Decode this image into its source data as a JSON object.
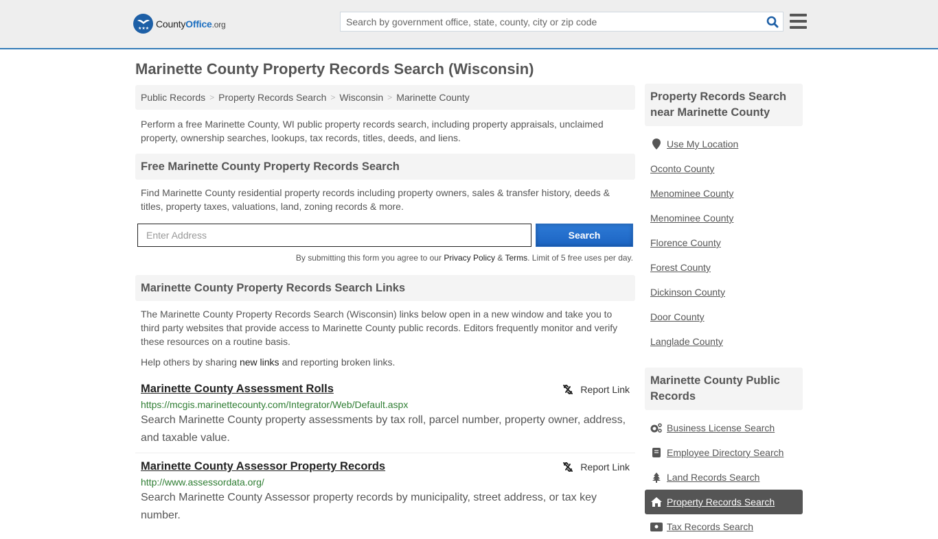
{
  "header": {
    "logo": {
      "county": "County",
      "office": "Office",
      "tld": ".org"
    },
    "search_placeholder": "Search by government office, state, county, city or zip code"
  },
  "page_title": "Marinette County Property Records Search (Wisconsin)",
  "breadcrumb": [
    "Public Records",
    "Property Records Search",
    "Wisconsin",
    "Marinette County"
  ],
  "intro": "Perform a free Marinette County, WI public property records search, including property appraisals, unclaimed property, ownership searches, lookups, tax records, titles, deeds, and liens.",
  "free_search": {
    "heading": "Free Marinette County Property Records Search",
    "description": "Find Marinette County residential property records including property owners, sales & transfer history, deeds & titles, property taxes, valuations, land, zoning records & more.",
    "address_placeholder": "Enter Address",
    "button_label": "Search",
    "disclaimer_prefix": "By submitting this form you agree to our ",
    "privacy_label": "Privacy Policy",
    "amp": " & ",
    "terms_label": "Terms",
    "disclaimer_suffix": ". Limit of 5 free uses per day."
  },
  "links_section": {
    "heading": "Marinette County Property Records Search Links",
    "description": "The Marinette County Property Records Search (Wisconsin) links below open in a new window and take you to third party websites that provide access to Marinette County public records. Editors frequently monitor and verify these resources on a routine basis.",
    "help_prefix": "Help others by sharing ",
    "help_link": "new links",
    "help_suffix": " and reporting broken links.",
    "report_label": "Report Link",
    "items": [
      {
        "title": "Marinette County Assessment Rolls",
        "url": "https://mcgis.marinettecounty.com/Integrator/Web/Default.aspx",
        "description": "Search Marinette County property assessments by tax roll, parcel number, property owner, address, and taxable value."
      },
      {
        "title": "Marinette County Assessor Property Records",
        "url": "http://www.assessordata.org/",
        "description": "Search Marinette County Assessor property records by municipality, street address, or tax key number."
      }
    ]
  },
  "sidebar": {
    "nearby": {
      "heading": "Property Records Search near Marinette County",
      "use_location": "Use My Location",
      "counties": [
        "Oconto County",
        "Menominee County",
        "Menominee County",
        "Florence County",
        "Forest County",
        "Dickinson County",
        "Door County",
        "Langlade County"
      ]
    },
    "public_records": {
      "heading": "Marinette County Public Records",
      "items": [
        {
          "label": "Business License Search",
          "icon": "gears-icon",
          "active": false
        },
        {
          "label": "Employee Directory Search",
          "icon": "book-icon",
          "active": false
        },
        {
          "label": "Land Records Search",
          "icon": "tree-icon",
          "active": false
        },
        {
          "label": "Property Records Search",
          "icon": "home-icon",
          "active": true
        },
        {
          "label": "Tax Records Search",
          "icon": "id-card-icon",
          "active": false
        }
      ]
    }
  },
  "colors": {
    "accent": "#337ab7",
    "button": "#1c64c2",
    "url_green": "#2e7d32",
    "active_bg": "#555555"
  }
}
